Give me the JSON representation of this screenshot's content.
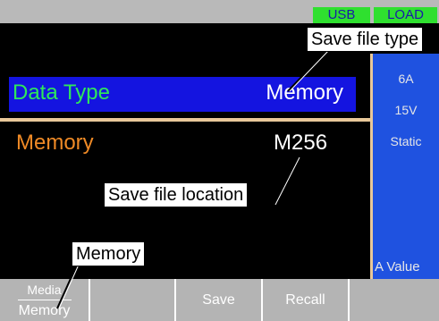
{
  "status": {
    "usb": "USB",
    "load": "LOAD",
    "indicator_color": "#2fe02f"
  },
  "side_panel": {
    "current": "6A",
    "voltage": "15V",
    "mode": "Static",
    "footer": "A Value"
  },
  "main": {
    "data_type_label": "Data Type",
    "data_type_value": "Memory",
    "memory_label": "Memory",
    "memory_value": "M256"
  },
  "softkeys": {
    "media_top": "Media",
    "media_bottom": "Memory",
    "save": "Save",
    "recall": "Recall"
  },
  "callouts": {
    "save_file_type": "Save file type",
    "save_file_location": "Save file location",
    "memory": "Memory"
  },
  "colors": {
    "highlight_row": "#1414e0",
    "side_panel": "#1f52e0",
    "data_type_label": "#2ee85a",
    "memory_label": "#ef8a26"
  }
}
